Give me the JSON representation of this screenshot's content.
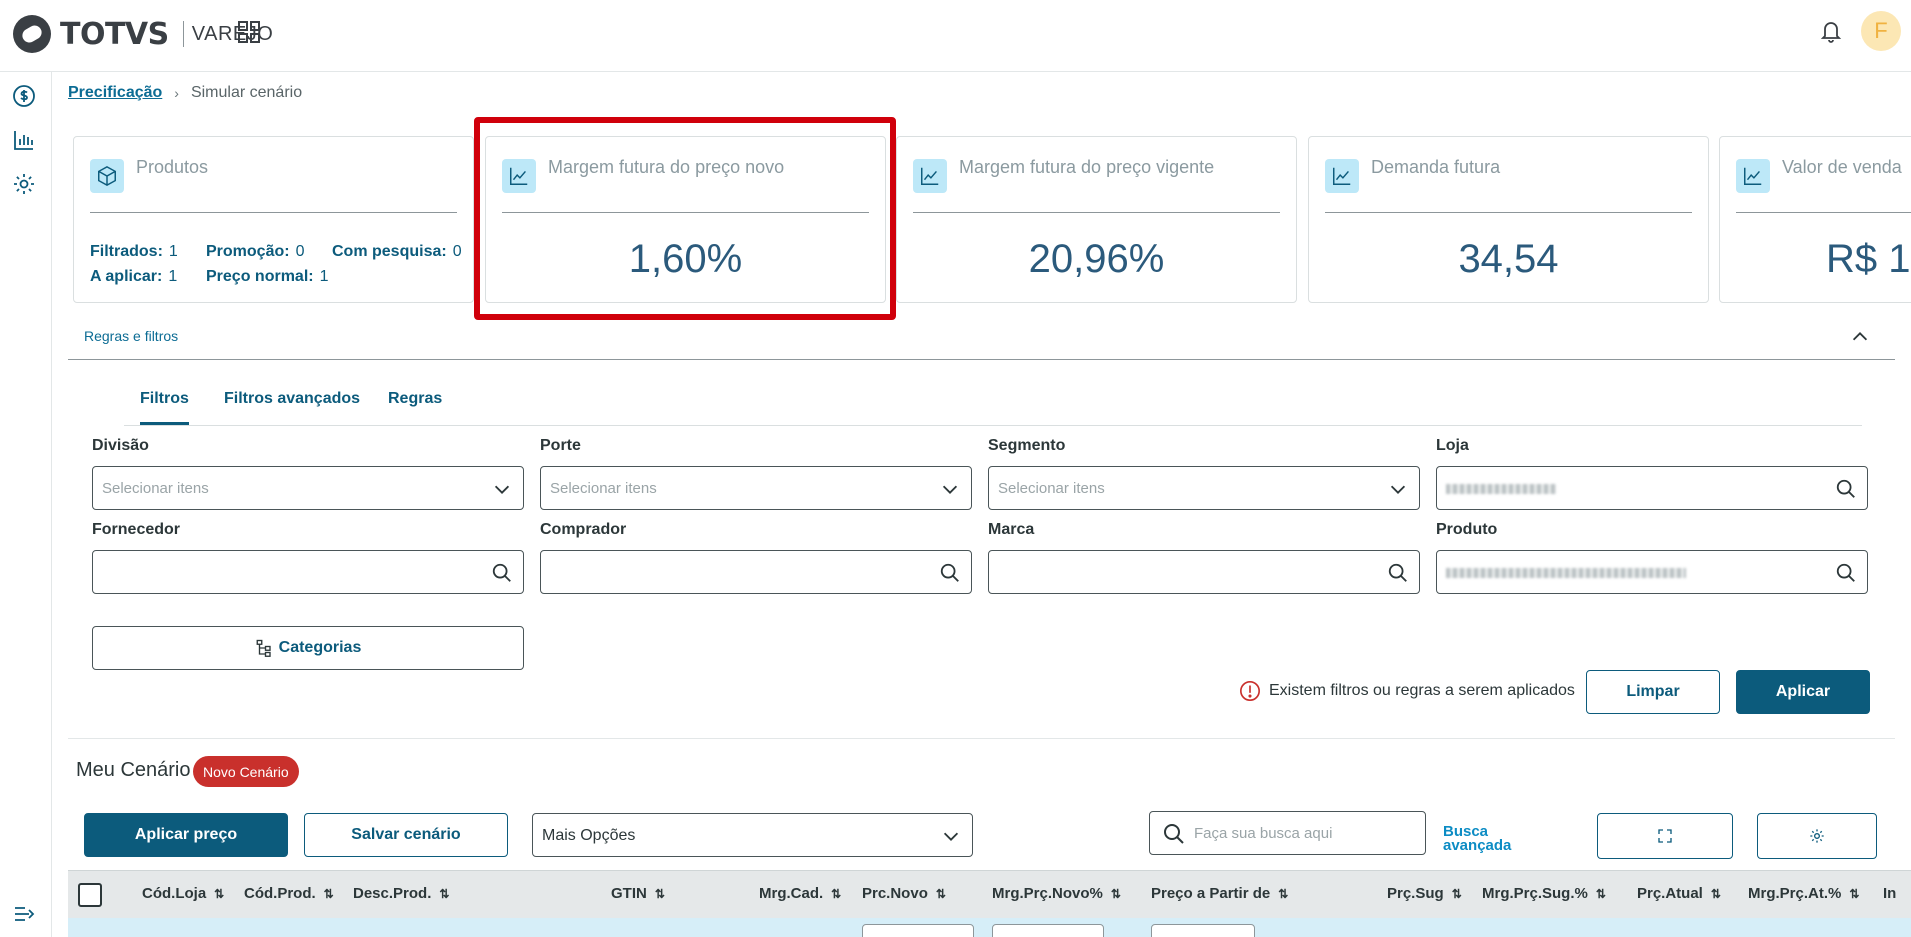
{
  "brand": {
    "name": "TOTVS",
    "product": "VAREJO"
  },
  "user": {
    "initial": "F"
  },
  "breadcrumb": {
    "parent": "Precificação",
    "current": "Simular cenário"
  },
  "cards": {
    "products": {
      "title": "Produtos",
      "filtrados_label": "Filtrados:",
      "filtrados": "1",
      "promocao_label": "Promoção:",
      "promocao": "0",
      "pesquisa_label": "Com pesquisa:",
      "pesquisa": "0",
      "aplicar_label": "A aplicar:",
      "aplicar": "1",
      "normal_label": "Preço normal:",
      "normal": "1"
    },
    "margin_new": {
      "title": "Margem futura do preço novo",
      "value": "1,60%"
    },
    "margin_current": {
      "title": "Margem futura do preço vigente",
      "value": "20,96%"
    },
    "demand": {
      "title": "Demanda futura",
      "value": "34,54"
    },
    "sales": {
      "title": "Valor de venda",
      "value": "R$ 1"
    }
  },
  "rules": {
    "label": "Regras e filtros"
  },
  "tabs": [
    "Filtros",
    "Filtros avançados",
    "Regras"
  ],
  "filters": {
    "divisao": {
      "label": "Divisão",
      "placeholder": "Selecionar itens"
    },
    "porte": {
      "label": "Porte",
      "placeholder": "Selecionar itens"
    },
    "segmento": {
      "label": "Segmento",
      "placeholder": "Selecionar itens"
    },
    "loja": {
      "label": "Loja"
    },
    "fornecedor": {
      "label": "Fornecedor"
    },
    "comprador": {
      "label": "Comprador"
    },
    "marca": {
      "label": "Marca"
    },
    "produto": {
      "label": "Produto"
    }
  },
  "actions": {
    "categorias": "Categorias",
    "notice": "Existem filtros ou regras a serem aplicados",
    "limpar": "Limpar",
    "aplicar": "Aplicar"
  },
  "scenario": {
    "title": "Meu Cenário",
    "badge": "Novo Cenário",
    "apply_price": "Aplicar preço",
    "save": "Salvar cenário",
    "more_options": "Mais Opções",
    "search_placeholder": "Faça sua busca aqui",
    "advanced_search_1": "Busca",
    "advanced_search_2": "avançada"
  },
  "table": {
    "columns": [
      "Cód.Loja",
      "Cód.Prod.",
      "Desc.Prod.",
      "GTIN",
      "Mrg.Cad.",
      "Prc.Novo",
      "Mrg.Prç.Novo%",
      "Preço a Partir de",
      "Prç.Sug",
      "Mrg.Prç.Sug.%",
      "Prç.Atual",
      "Mrg.Prç.At.%",
      "In"
    ]
  },
  "colors": {
    "primary": "#0c5b7c",
    "highlight": "#d0000b",
    "badge": "#c9302c",
    "icon_bg": "#bde8f8"
  }
}
